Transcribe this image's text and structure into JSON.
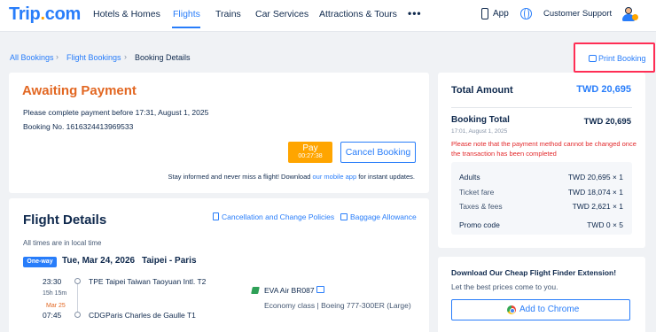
{
  "nav": {
    "logo_main": "Trip",
    "logo_dot": ".",
    "logo_tld": "com",
    "items": [
      "Hotels & Homes",
      "Flights",
      "Trains",
      "Car Services",
      "Attractions & Tours"
    ],
    "more": "•••",
    "app": "App",
    "support": "Customer Support"
  },
  "breadcrumb": {
    "all_bookings": "All Bookings",
    "flight_bookings": "Flight Bookings",
    "current": "Booking Details",
    "sep": "›"
  },
  "print": {
    "label": "Print Booking"
  },
  "awaiting": {
    "title": "Awaiting Payment",
    "deadline": "Please complete payment before 17:31, August 1, 2025",
    "booking_no": "Booking No. 1616324413969533",
    "pay_label": "Pay",
    "pay_timer": "00:27:38",
    "cancel_label": "Cancel Booking",
    "stay_pre": "Stay informed and never miss a flight! Download ",
    "stay_link": "our mobile app",
    "stay_post": " for instant updates."
  },
  "flight": {
    "title": "Flight Details",
    "policies": "Cancellation and Change Policies",
    "baggage": "Baggage Allowance",
    "local_time": "All times are in local time",
    "oneway": "One-way",
    "date": "Tue, Mar 24, 2026",
    "cities": "Taipei - Paris",
    "dep_time": "23:30",
    "dep_code": "TPE",
    "dep_airport": "Taipei Taiwan Taoyuan Intl. T2",
    "duration": "15h 15m",
    "arr_date": "Mar 25",
    "arr_time": "07:45",
    "arr_code": "CDG",
    "arr_airport": "Paris Charles de Gaulle T1",
    "airline": "EVA Air BR087",
    "cabin": "Economy class  |  Boeing 777-300ER (Large)"
  },
  "summary": {
    "total_label": "Total Amount",
    "total_value": "TWD 20,695",
    "booking_total_label": "Booking Total",
    "booking_total_value": "TWD 20,695",
    "booking_time": "17:01, August 1, 2025",
    "note": "Please note that the payment method cannot be changed once the transaction has been completed",
    "rows": [
      {
        "label": "Adults",
        "value": "TWD 20,695 × 1"
      },
      {
        "label": "Ticket fare",
        "value": "TWD 18,074 × 1"
      },
      {
        "label": "Taxes & fees",
        "value": "TWD 2,621 × 1"
      },
      {
        "label": "Promo code",
        "value": "TWD 0 × 5"
      }
    ]
  },
  "extension": {
    "title": "Download Our Cheap Flight Finder Extension!",
    "subtitle": "Let the best prices come to you.",
    "button": "Add to Chrome"
  },
  "colors": {
    "brand": "#287dfa",
    "accent": "#ffa500",
    "await": "#e26722",
    "warning": "#e2282b",
    "highlight": "#ff2e55"
  }
}
